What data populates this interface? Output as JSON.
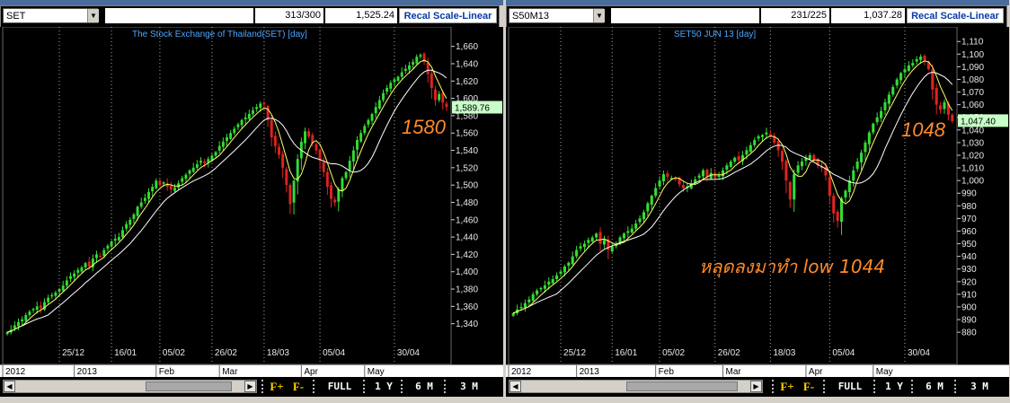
{
  "colors": {
    "up": "#33dd33",
    "down": "#e02222",
    "ma": "#ffff66",
    "ma2": "#ffffff",
    "annotation": "#ff8a2a",
    "title": "#4da6ff"
  },
  "panels": [
    {
      "symbol": "SET",
      "counter": "313/300",
      "header_value": "1,525.24",
      "scale_label": "Recal Scale-Linear",
      "title": "The Stock Exchange of Thailand(SET) [day]",
      "price_label": "1,589.76",
      "annotation": "1580",
      "xticks": [
        "25/12",
        "16/01",
        "05/02",
        "26/02",
        "18/03",
        "05/04",
        "30/04"
      ],
      "months": [
        "2012",
        "2013",
        "Feb",
        "Mar",
        "Apr",
        "May"
      ],
      "buttons": {
        "f_plus": "F+",
        "f_minus": "F-",
        "full": "FULL",
        "y1": "1 Y",
        "m6": "6 M",
        "m3": "3 M"
      }
    },
    {
      "symbol": "S50M13",
      "counter": "231/225",
      "header_value": "1,037.28",
      "scale_label": "Recal Scale-Linear",
      "title": "SET50 JUN 13  [day]",
      "price_label": "1,047.40",
      "annotation": "1048",
      "annotation2": "หลุดลงมาทำ low 1044",
      "xticks": [
        "25/12",
        "16/01",
        "05/02",
        "26/02",
        "18/03",
        "05/04",
        "30/04"
      ],
      "months": [
        "2012",
        "2013",
        "Feb",
        "Mar",
        "Apr",
        "May"
      ],
      "buttons": {
        "f_plus": "F+",
        "f_minus": "F-",
        "full": "FULL",
        "y1": "1 Y",
        "m6": "6 M",
        "m3": "3 M"
      }
    }
  ],
  "chart_data": [
    {
      "type": "candlestick",
      "title": "The Stock Exchange of Thailand(SET) [day]",
      "ylim": [
        1320,
        1670
      ],
      "yticks": [
        1340,
        1360,
        1380,
        1400,
        1420,
        1440,
        1460,
        1480,
        1500,
        1520,
        1540,
        1560,
        1580,
        1600,
        1620,
        1640,
        1660
      ],
      "close": [
        1330,
        1333,
        1338,
        1342,
        1345,
        1350,
        1354,
        1357,
        1360,
        1358,
        1365,
        1370,
        1373,
        1376,
        1380,
        1384,
        1390,
        1395,
        1398,
        1402,
        1405,
        1410,
        1406,
        1415,
        1420,
        1418,
        1425,
        1430,
        1435,
        1438,
        1440,
        1448,
        1455,
        1460,
        1466,
        1475,
        1480,
        1485,
        1492,
        1498,
        1505,
        1500,
        1503,
        1498,
        1495,
        1497,
        1502,
        1508,
        1512,
        1517,
        1520,
        1524,
        1528,
        1525,
        1530,
        1534,
        1538,
        1545,
        1550,
        1555,
        1560,
        1565,
        1570,
        1575,
        1578,
        1582,
        1586,
        1590,
        1594,
        1593,
        1575,
        1555,
        1545,
        1535,
        1520,
        1500,
        1478,
        1505,
        1530,
        1550,
        1562,
        1556,
        1548,
        1540,
        1528,
        1515,
        1498,
        1484,
        1480,
        1495,
        1508,
        1515,
        1528,
        1540,
        1552,
        1560,
        1568,
        1575,
        1582,
        1590,
        1598,
        1606,
        1612,
        1618,
        1622,
        1625,
        1630,
        1634,
        1638,
        1642,
        1648,
        1650,
        1642,
        1628,
        1612,
        1598,
        1605,
        1595,
        1590
      ]
    },
    {
      "type": "candlestick",
      "title": "SET50 JUN 13  [day]",
      "ylim": [
        873,
        1113
      ],
      "yticks": [
        880,
        890,
        900,
        910,
        920,
        930,
        940,
        950,
        960,
        970,
        980,
        990,
        1000,
        1010,
        1020,
        1030,
        1040,
        1050,
        1060,
        1070,
        1080,
        1090,
        1100,
        1110
      ],
      "close": [
        895,
        898,
        900,
        903,
        906,
        910,
        913,
        915,
        917,
        920,
        922,
        925,
        928,
        932,
        935,
        940,
        945,
        948,
        950,
        953,
        955,
        958,
        950,
        953,
        945,
        948,
        950,
        955,
        958,
        960,
        962,
        966,
        970,
        975,
        982,
        988,
        994,
        1000,
        1005,
        1003,
        1002,
        1001,
        997,
        994,
        995,
        998,
        1001,
        1004,
        1008,
        1003,
        1006,
        1002,
        1004,
        1008,
        1012,
        1015,
        1018,
        1016,
        1020,
        1024,
        1028,
        1032,
        1035,
        1036,
        1038,
        1035,
        1030,
        1024,
        1015,
        1000,
        985,
        1005,
        1012,
        1015,
        1018,
        1020,
        1016,
        1012,
        1010,
        1004,
        988,
        974,
        968,
        986,
        992,
        1000,
        1008,
        1015,
        1022,
        1030,
        1038,
        1045,
        1050,
        1055,
        1062,
        1068,
        1074,
        1080,
        1085,
        1088,
        1091,
        1093,
        1096,
        1098,
        1095,
        1088,
        1072,
        1060,
        1056,
        1062,
        1052,
        1047
      ]
    }
  ]
}
